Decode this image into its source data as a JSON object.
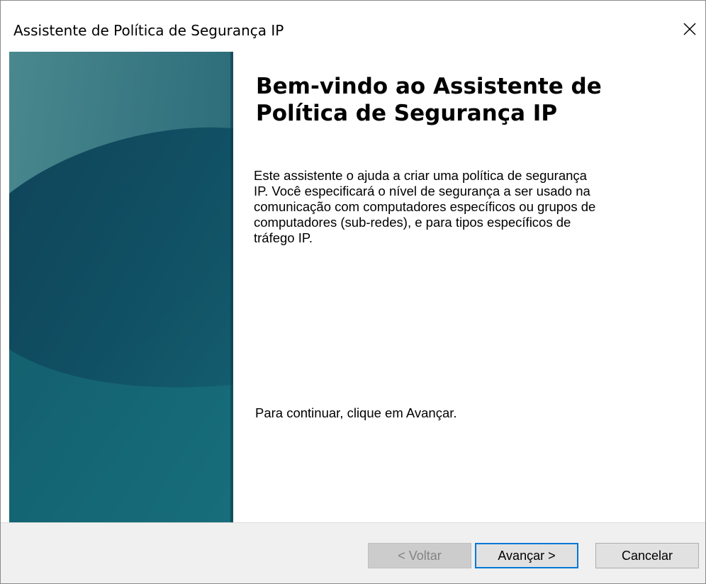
{
  "window": {
    "title": "Assistente de Política de Segurança IP"
  },
  "main": {
    "heading": "Bem-vindo ao Assistente de\nPolítica de Segurança IP",
    "description": "Este assistente o ajuda a criar uma política de segurança\nIP. Você especificará o nível de segurança a ser usado na\ncomunicação com computadores específicos ou grupos de\ncomputadores (sub-redes), e para tipos específicos de\ntráfego IP.",
    "continue_text": "Para continuar, clique em Avançar."
  },
  "buttons": {
    "back_label": "< Voltar",
    "next_label": "Avançar >",
    "cancel_label": "Cancelar"
  },
  "colors": {
    "banner_dark": "#0f4a5e",
    "banner_mid": "#1b6e7c",
    "banner_light": "#2c8f92",
    "focus_border": "#0078d7"
  },
  "icons": {
    "close": "close-icon"
  }
}
